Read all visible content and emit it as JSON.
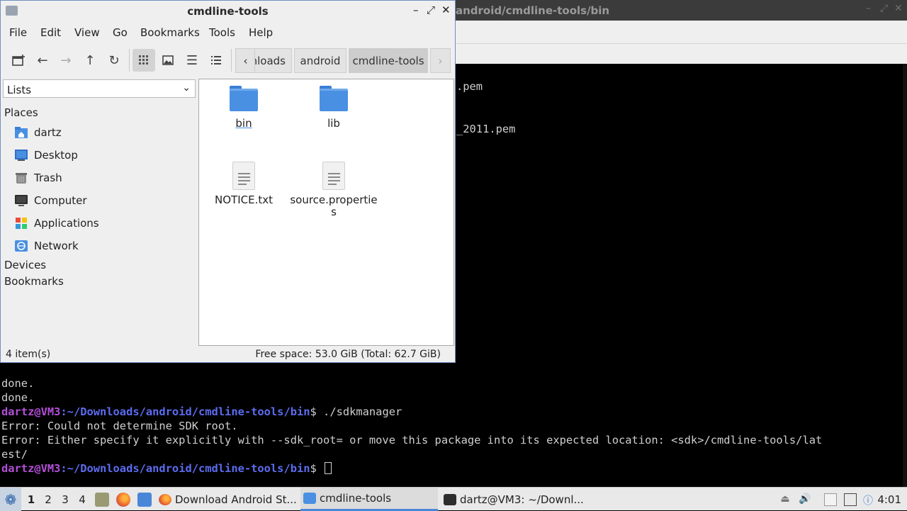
{
  "terminal": {
    "title": "android/cmdline-tools/bin",
    "partial_lines": [
      ".pem",
      "_2011.pem"
    ],
    "lines": [
      {
        "kind": "text",
        "text": "done."
      },
      {
        "kind": "text",
        "text": "done."
      },
      {
        "kind": "prompt",
        "user": "dartz@VM3",
        "path": ":~/Downloads/android/cmdline-tools/bin",
        "cmd": "$ ./sdkmanager"
      },
      {
        "kind": "text",
        "text": "Error: Could not determine SDK root."
      },
      {
        "kind": "text",
        "text": "Error: Either specify it explicitly with --sdk_root= or move this package into its expected location: <sdk>/cmdline-tools/lat"
      },
      {
        "kind": "text",
        "text": "est/"
      },
      {
        "kind": "prompt",
        "user": "dartz@VM3",
        "path": ":~/Downloads/android/cmdline-tools/bin",
        "cmd": "$ "
      }
    ]
  },
  "file_manager": {
    "title": "cmdline-tools",
    "menu": [
      "File",
      "Edit",
      "View",
      "Go",
      "Bookmarks",
      "Tools",
      "Help"
    ],
    "breadcrumbs": [
      "nloads",
      "android",
      "cmdline-tools"
    ],
    "side_pane_mode": "Lists",
    "places_heading": "Places",
    "places": [
      {
        "label": "dartz",
        "icon": "home-folder-icon"
      },
      {
        "label": "Desktop",
        "icon": "desktop-icon"
      },
      {
        "label": "Trash",
        "icon": "trash-icon"
      },
      {
        "label": "Computer",
        "icon": "computer-icon"
      },
      {
        "label": "Applications",
        "icon": "applications-icon"
      },
      {
        "label": "Network",
        "icon": "network-icon"
      }
    ],
    "devices_heading": "Devices",
    "bookmarks_heading": "Bookmarks",
    "files": [
      {
        "name": "bin",
        "type": "folder"
      },
      {
        "name": "lib",
        "type": "folder"
      },
      {
        "name": "NOTICE.txt",
        "type": "file"
      },
      {
        "name": "source.properties",
        "type": "file"
      }
    ],
    "status": {
      "count": "4 item(s)",
      "free_space": "Free space: 53.0 GiB (Total: 62.7 GiB)"
    }
  },
  "taskbar": {
    "workspaces": [
      "1",
      "2",
      "3",
      "4"
    ],
    "active_workspace": "1",
    "tasks": [
      {
        "label": "Download Android St...",
        "icon": "firefox-icon"
      },
      {
        "label": "cmdline-tools",
        "icon": "folder-icon"
      },
      {
        "label": "dartz@VM3: ~/Downl...",
        "icon": "terminal-icon"
      }
    ],
    "clock": "4:01"
  }
}
